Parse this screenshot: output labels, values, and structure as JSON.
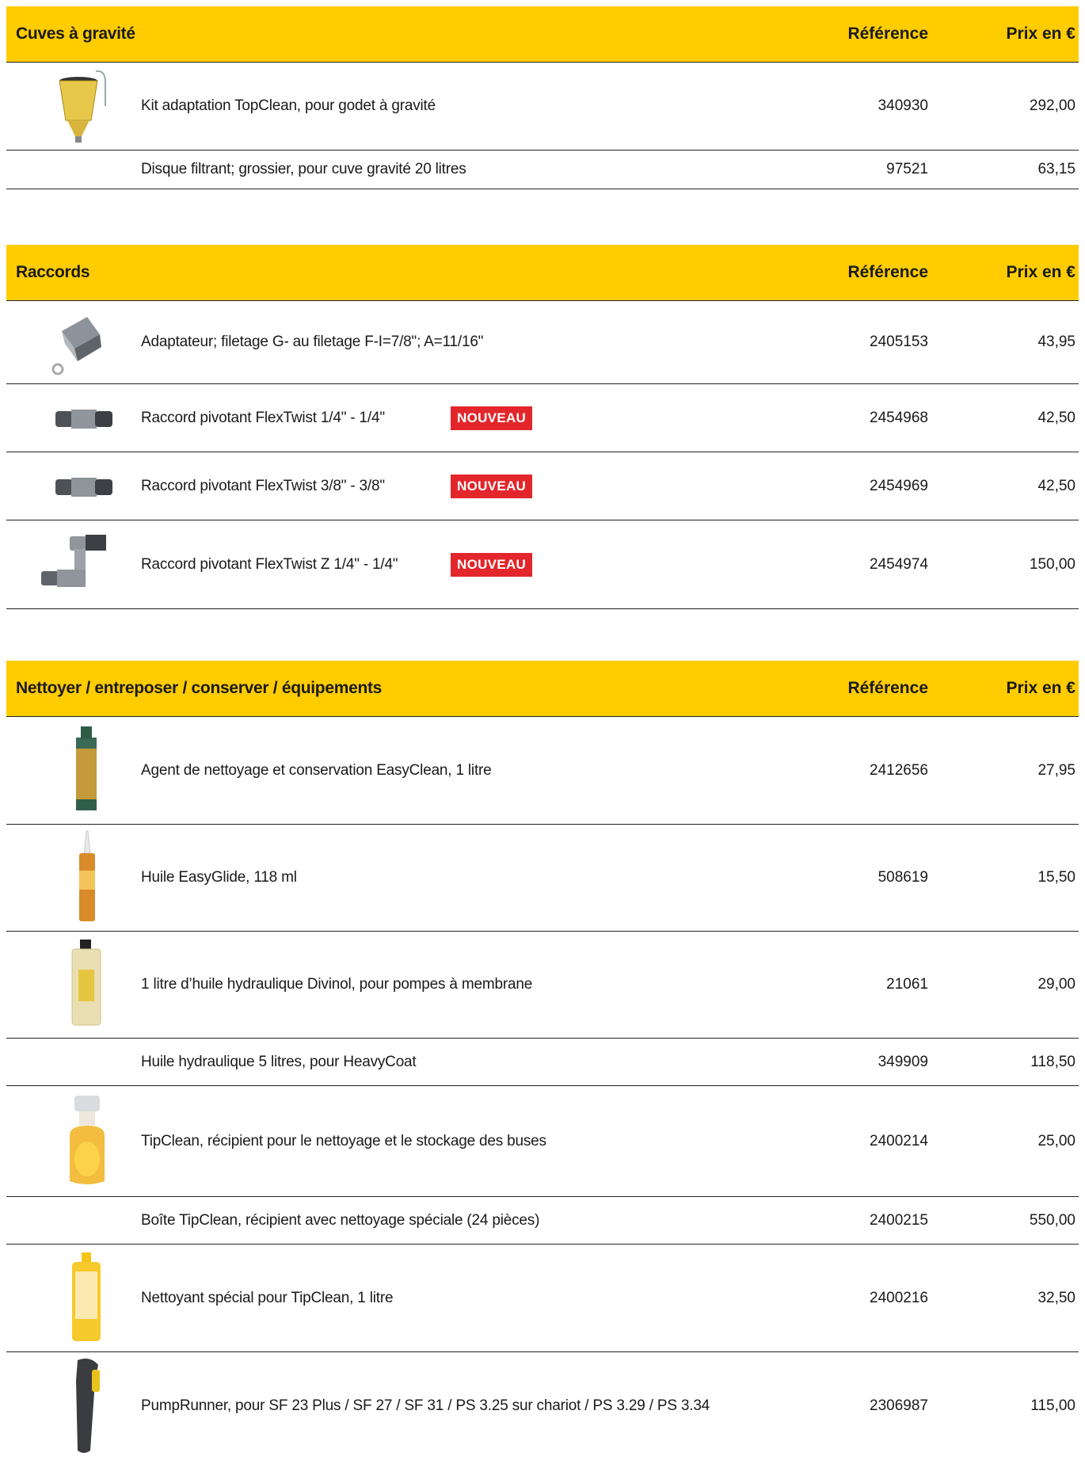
{
  "sections": [
    {
      "title": "Cuves à gravité",
      "col_ref": "Référence",
      "col_price": "Prix en €",
      "rows": [
        {
          "desc": "Kit adaptation TopClean, pour godet à gravité",
          "ref": "340930",
          "price": "292,00",
          "image": "gravity-cup-image"
        },
        {
          "desc": "Disque filtrant; grossier, pour cuve gravité 20 litres",
          "ref": "97521",
          "price": "63,15"
        }
      ]
    },
    {
      "title": "Raccords",
      "col_ref": "Référence",
      "col_price": "Prix en €",
      "rows": [
        {
          "desc": "Adaptateur; filetage G- au filetage F-I=7/8\"; A=11/16\"",
          "ref": "2405153",
          "price": "43,95",
          "image": "adapter-image"
        },
        {
          "desc": "Raccord pivotant FlexTwist 1/4\" - 1/4\"",
          "badge": "NOUVEAU",
          "ref": "2454968",
          "price": "42,50",
          "image": "swivel-joint-image"
        },
        {
          "desc": "Raccord pivotant FlexTwist 3/8\" - 3/8\"",
          "badge": "NOUVEAU",
          "ref": "2454969",
          "price": "42,50",
          "image": "swivel-joint-image"
        },
        {
          "desc": "Raccord pivotant FlexTwist Z 1/4\" - 1/4\"",
          "badge": "NOUVEAU",
          "ref": "2454974",
          "price": "150,00",
          "image": "z-swivel-joint-image"
        }
      ]
    },
    {
      "title": "Nettoyer / entreposer / conserver / équipements",
      "col_ref": "Référence",
      "col_price": "Prix en €",
      "rows": [
        {
          "desc": "Agent de nettoyage et conservation EasyClean, 1 litre",
          "ref": "2412656",
          "price": "27,95",
          "image": "cleaning-bottle-image"
        },
        {
          "desc": "Huile EasyGlide, 118 ml",
          "ref": "508619",
          "price": "15,50",
          "image": "oil-bottle-image"
        },
        {
          "desc": "1 litre d’huile hydraulique Divinol, pour pompes à membrane",
          "ref": "21061",
          "price": "29,00",
          "image": "hydraulic-oil-bottle-image"
        },
        {
          "desc": "Huile hydraulique 5 litres, pour HeavyCoat",
          "ref": "349909",
          "price": "118,50"
        },
        {
          "desc": "TipClean, récipient pour le nettoyage et le stockage des buses",
          "ref": "2400214",
          "price": "25,00",
          "image": "tipclean-container-image"
        },
        {
          "desc": "Boîte TipClean, récipient avec nettoyage spéciale (24 pièces)",
          "ref": "2400215",
          "price": "550,00"
        },
        {
          "desc": "Nettoyant spécial pour TipClean, 1 litre",
          "ref": "2400216",
          "price": "32,50",
          "image": "cleaner-bottle-image"
        },
        {
          "desc": "PumpRunner, pour SF 23 Plus / SF 27 / SF 31 / PS 3.25 sur chariot / PS 3.29 / PS 3.34",
          "ref": "2306987",
          "price": "115,00",
          "image": "pumprunner-remote-image"
        }
      ]
    }
  ]
}
